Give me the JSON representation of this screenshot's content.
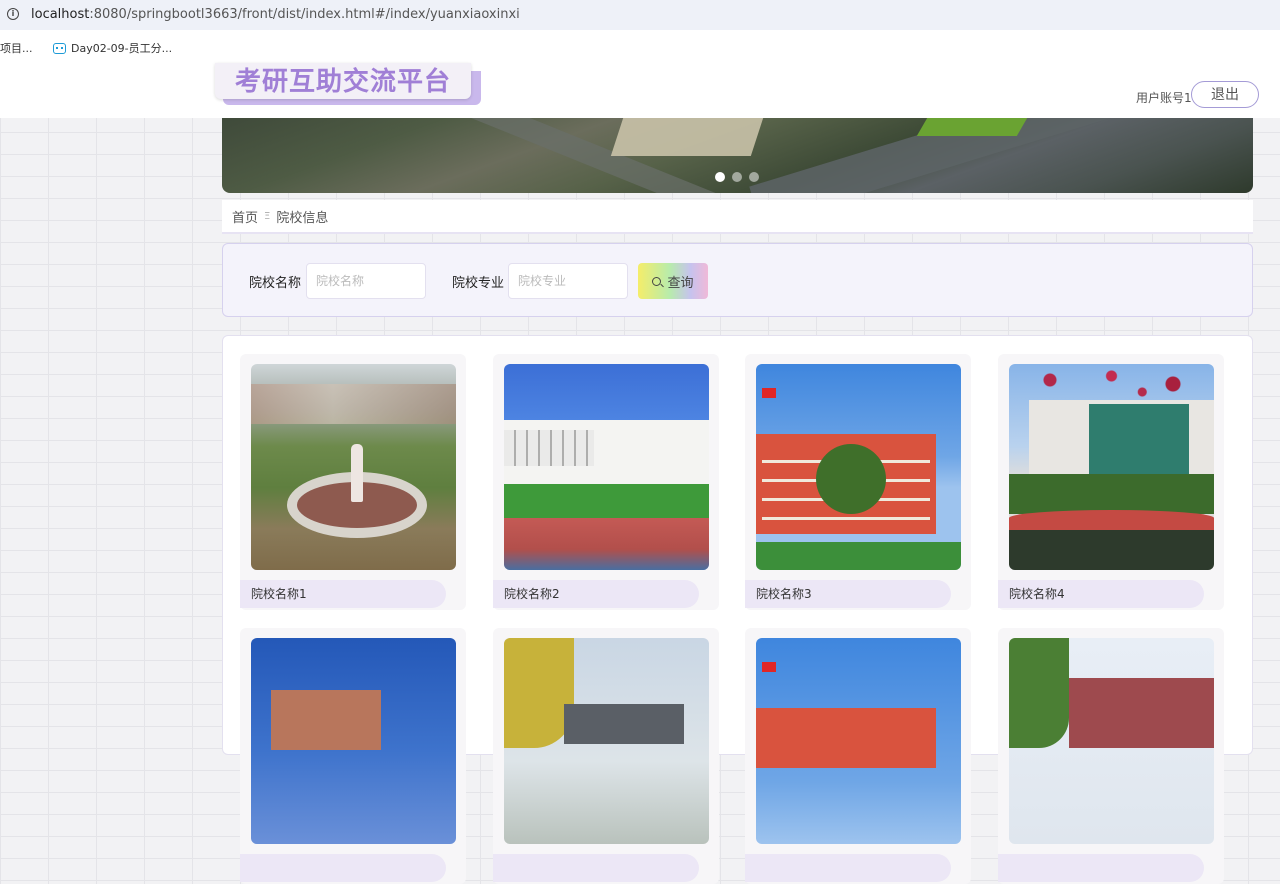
{
  "browser": {
    "url_host": "localhost",
    "url_path": ":8080/springbootl3663/front/dist/index.html#/index/yuanxiaoxinxi",
    "bookmarks": [
      "项目...",
      "Day02-09-员工分..."
    ]
  },
  "header": {
    "logo_text": "考研互助交流平台",
    "user_account": "用户账号1",
    "logout_label": "退出"
  },
  "banner": {
    "slide_count": 3,
    "active_slide": 1
  },
  "breadcrumb": {
    "home": "首页",
    "separator": "Ξ",
    "current": "院校信息"
  },
  "search": {
    "name_label": "院校名称",
    "name_placeholder": "院校名称",
    "major_label": "院校专业",
    "major_placeholder": "院校专业",
    "button_label": "查询"
  },
  "schools": [
    {
      "name": "院校名称1"
    },
    {
      "name": "院校名称2"
    },
    {
      "name": "院校名称3"
    },
    {
      "name": "院校名称4"
    },
    {
      "name": ""
    },
    {
      "name": ""
    },
    {
      "name": ""
    },
    {
      "name": ""
    }
  ],
  "colors": {
    "accent": "#a07fd6",
    "border": "#a49bd6",
    "card_label_bg": "#ece7f6"
  }
}
